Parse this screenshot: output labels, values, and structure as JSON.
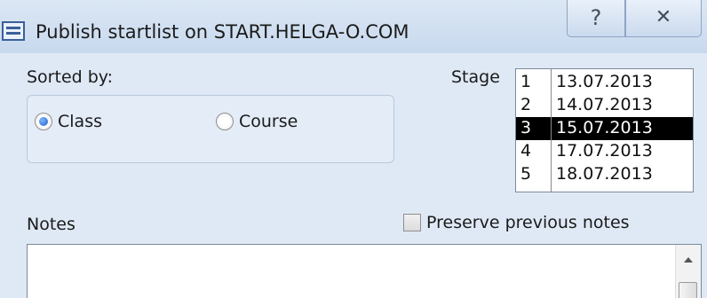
{
  "window": {
    "title": "Publish startlist on START.HELGA-O.COM",
    "help_glyph": "?",
    "close_glyph": "✕"
  },
  "sorted_by": {
    "label": "Sorted by:",
    "options": [
      {
        "label": "Class",
        "checked": true
      },
      {
        "label": "Course",
        "checked": false
      }
    ]
  },
  "stage": {
    "label": "Stage",
    "items": [
      {
        "num": "1",
        "date": "13.07.2013",
        "selected": false
      },
      {
        "num": "2",
        "date": "14.07.2013",
        "selected": false
      },
      {
        "num": "3",
        "date": "15.07.2013",
        "selected": true
      },
      {
        "num": "4",
        "date": "17.07.2013",
        "selected": false
      },
      {
        "num": "5",
        "date": "18.07.2013",
        "selected": false
      }
    ]
  },
  "notes": {
    "label": "Notes",
    "value": "",
    "preserve_label": "Preserve previous notes",
    "preserve_checked": false
  }
}
